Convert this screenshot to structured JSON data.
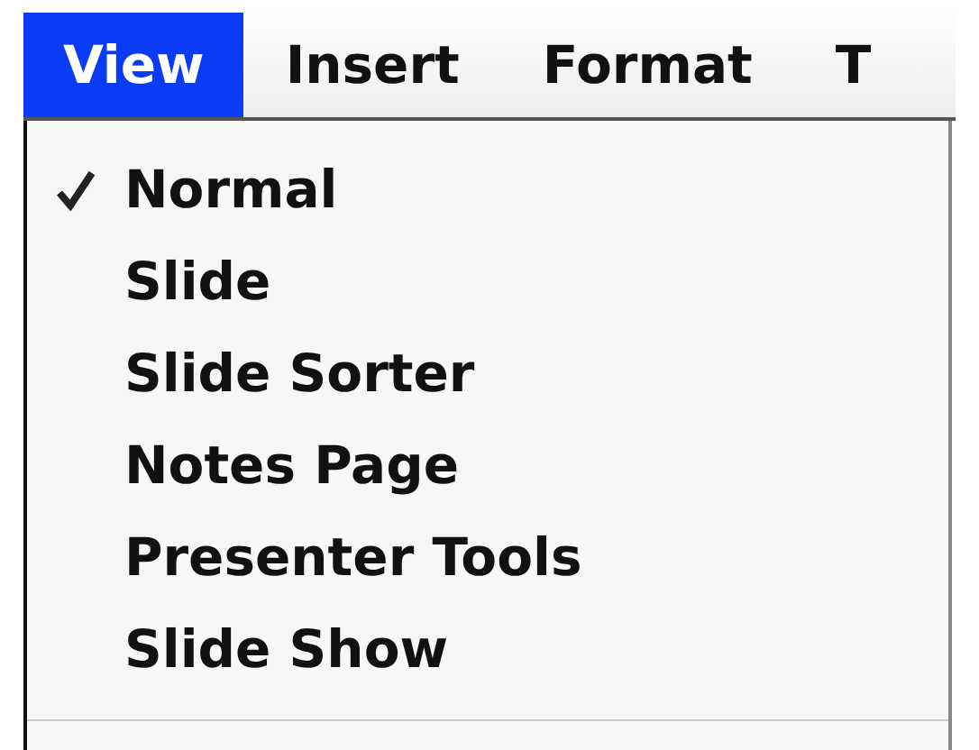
{
  "menubar": [
    {
      "label": "View",
      "selected": true
    },
    {
      "label": "Insert",
      "selected": false
    },
    {
      "label": "Format",
      "selected": false
    },
    {
      "label": "T",
      "selected": false
    }
  ],
  "menu": {
    "items": [
      {
        "label": "Normal",
        "checked": true
      },
      {
        "label": "Slide",
        "checked": false
      },
      {
        "label": "Slide Sorter",
        "checked": false
      },
      {
        "label": "Notes Page",
        "checked": false
      },
      {
        "label": "Presenter Tools",
        "checked": false
      },
      {
        "label": "Slide Show",
        "checked": false
      }
    ]
  }
}
